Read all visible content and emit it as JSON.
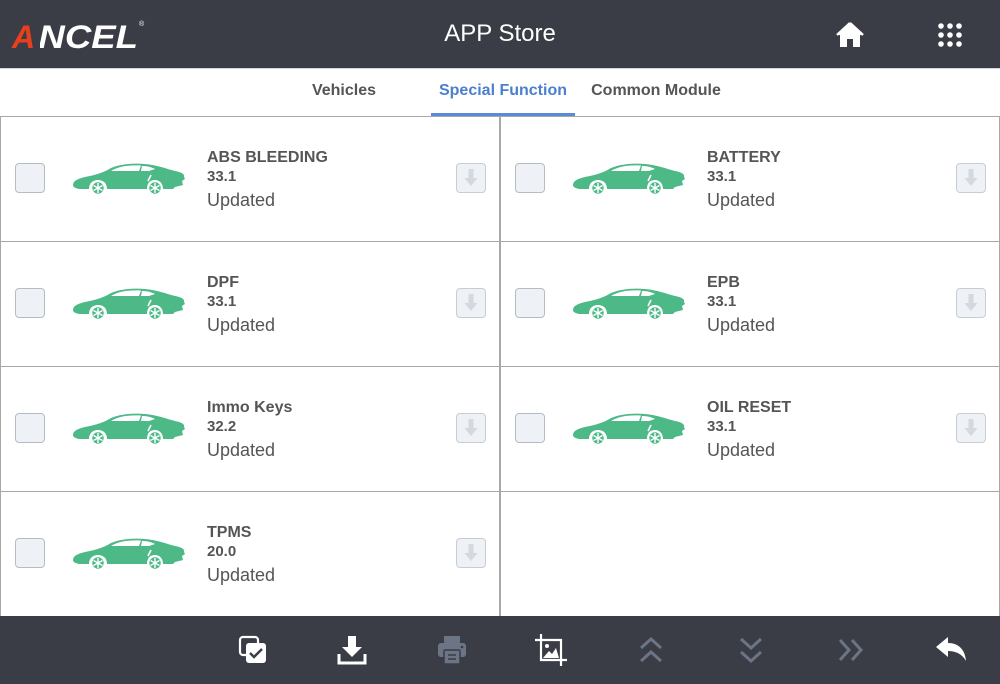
{
  "header": {
    "brand": "ANCEL",
    "title": "APP Store",
    "home_icon": "home-icon",
    "menu_icon": "grid-menu-icon"
  },
  "tabs": [
    {
      "label": "Vehicles",
      "active": false
    },
    {
      "label": "Special Function",
      "active": true
    },
    {
      "label": "Common Module",
      "active": false
    }
  ],
  "items": [
    {
      "name": "ABS BLEEDING",
      "version": "33.1",
      "status": "Updated",
      "checked": false
    },
    {
      "name": "BATTERY",
      "version": "33.1",
      "status": "Updated",
      "checked": false
    },
    {
      "name": "DPF",
      "version": "33.1",
      "status": "Updated",
      "checked": false
    },
    {
      "name": "EPB",
      "version": "33.1",
      "status": "Updated",
      "checked": false
    },
    {
      "name": "Immo Keys",
      "version": "32.2",
      "status": "Updated",
      "checked": false
    },
    {
      "name": "OIL RESET",
      "version": "33.1",
      "status": "Updated",
      "checked": false
    },
    {
      "name": "TPMS",
      "version": "20.0",
      "status": "Updated",
      "checked": false
    }
  ],
  "toolbar": [
    {
      "icon": "select-all-icon",
      "enabled": true
    },
    {
      "icon": "download-icon",
      "enabled": true
    },
    {
      "icon": "print-icon",
      "enabled": false
    },
    {
      "icon": "screenshot-icon",
      "enabled": true
    },
    {
      "icon": "page-up-icon",
      "enabled": false
    },
    {
      "icon": "page-down-icon",
      "enabled": false
    },
    {
      "icon": "next-icon",
      "enabled": false
    },
    {
      "icon": "back-icon",
      "enabled": true
    }
  ],
  "colors": {
    "header_bg": "#3a3d45",
    "accent": "#4b7fcf",
    "car_green": "#4cb987",
    "logo_red": "#e8401c",
    "disabled_icon": "#6b7585"
  }
}
